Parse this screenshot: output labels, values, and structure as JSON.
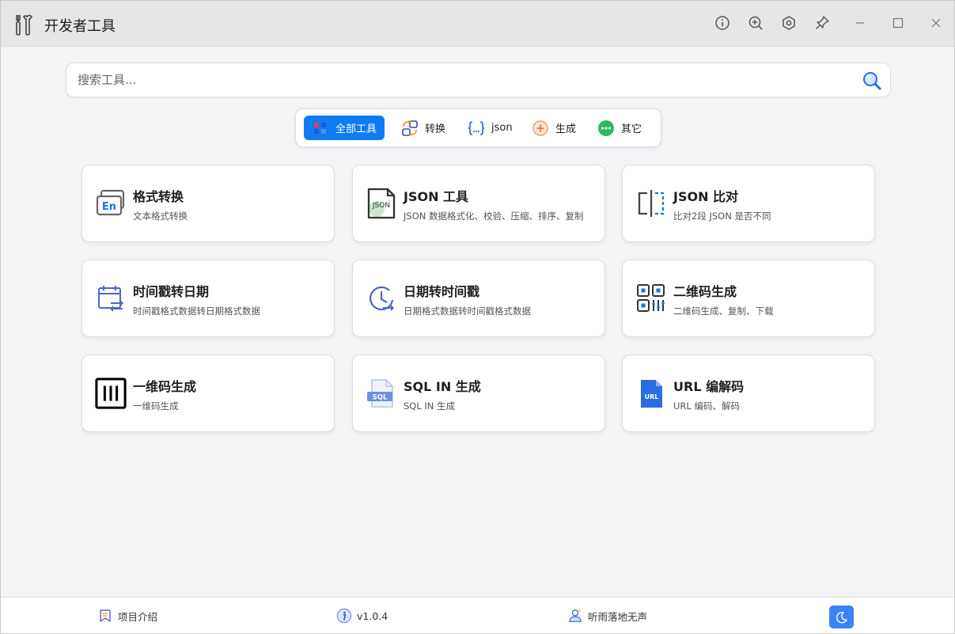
{
  "app": {
    "title": "开发者工具"
  },
  "search": {
    "placeholder": "搜索工具..."
  },
  "tabs": [
    {
      "label": "全部工具",
      "icon": "grid-icon",
      "active": true
    },
    {
      "label": "转换",
      "icon": "convert-icon",
      "active": false
    },
    {
      "label": "json",
      "icon": "json-braces-icon",
      "active": false
    },
    {
      "label": "生成",
      "icon": "plus-circle-icon",
      "active": false
    },
    {
      "label": "其它",
      "icon": "more-icon",
      "active": false
    }
  ],
  "tools": [
    {
      "title": "格式转换",
      "desc": "文本格式转换",
      "icon": "text-format-icon"
    },
    {
      "title": "JSON 工具",
      "desc": "JSON 数据格式化、校验、压缩、排序、复制",
      "icon": "json-file-icon"
    },
    {
      "title": "JSON 比对",
      "desc": "比对2段 JSON 是否不同",
      "icon": "compare-icon"
    },
    {
      "title": "时间戳转日期",
      "desc": "时间戳格式数据转日期格式数据",
      "icon": "calendar-convert-icon"
    },
    {
      "title": "日期转时间戳",
      "desc": "日期格式数据转时间戳格式数据",
      "icon": "clock-convert-icon"
    },
    {
      "title": "二维码生成",
      "desc": "二维码生成、复制、下载",
      "icon": "qrcode-icon"
    },
    {
      "title": "一维码生成",
      "desc": "一维码生成",
      "icon": "barcode-icon"
    },
    {
      "title": "SQL IN 生成",
      "desc": "SQL IN 生成",
      "icon": "sql-file-icon"
    },
    {
      "title": "URL 编解码",
      "desc": "URL 编码、解码",
      "icon": "url-file-icon"
    }
  ],
  "footer": {
    "project": "项目介绍",
    "version": "v1.0.4",
    "author": "听雨落地无声"
  },
  "colors": {
    "accent": "#0e7bf3",
    "theme_button": "#3b82f6"
  }
}
